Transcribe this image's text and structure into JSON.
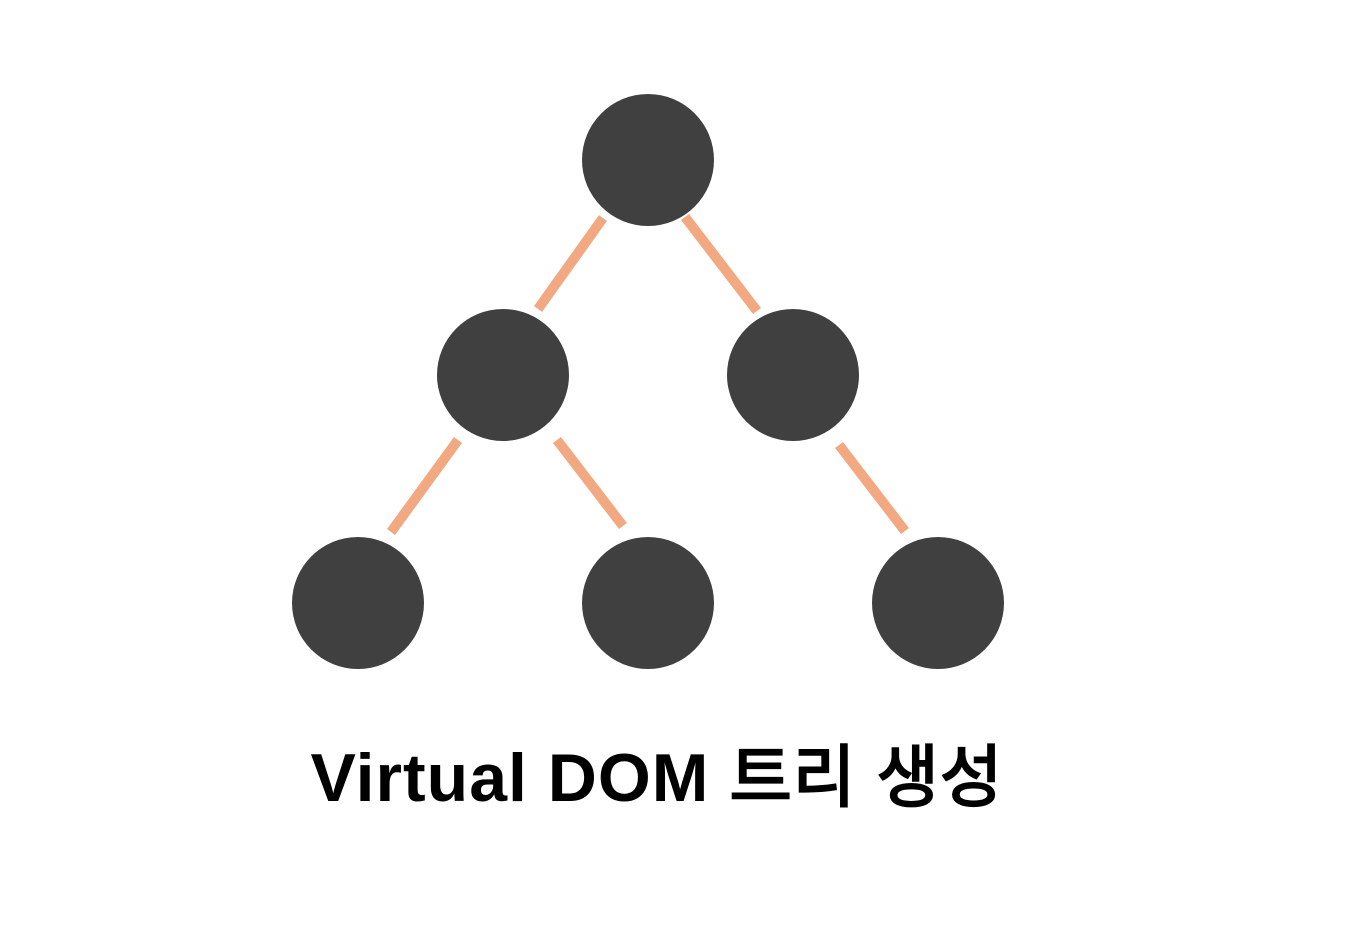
{
  "diagram": {
    "caption": "Virtual DOM 트리 생성",
    "colors": {
      "node": "#404040",
      "edge": "#f2a982",
      "background": "#ffffff",
      "caption": "#000000"
    },
    "nodes": [
      {
        "id": "root"
      },
      {
        "id": "left-child"
      },
      {
        "id": "right-child"
      },
      {
        "id": "left-left-grandchild"
      },
      {
        "id": "left-right-grandchild"
      },
      {
        "id": "right-right-grandchild"
      }
    ],
    "edges": [
      {
        "from": "root",
        "to": "left-child"
      },
      {
        "from": "root",
        "to": "right-child"
      },
      {
        "from": "left-child",
        "to": "left-left-grandchild"
      },
      {
        "from": "left-child",
        "to": "left-right-grandchild"
      },
      {
        "from": "right-child",
        "to": "right-right-grandchild"
      }
    ]
  }
}
